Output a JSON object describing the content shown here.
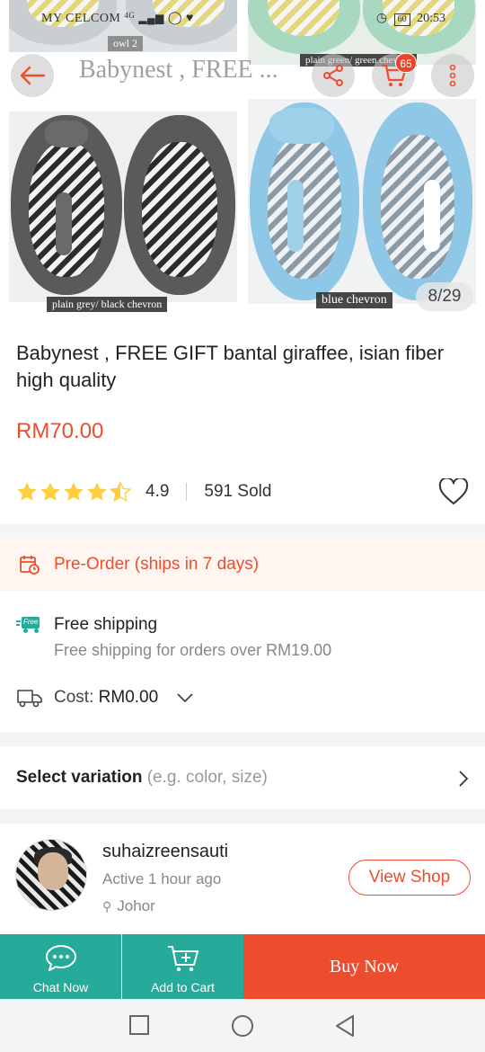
{
  "status_bar": {
    "carrier": "MY CELCOM",
    "network": "4G",
    "battery": "60",
    "time": "20:53"
  },
  "toolbar": {
    "title": "Babynest , FREE ...",
    "cart_count": "65",
    "icons": [
      "back-arrow-icon",
      "share-icon",
      "cart-icon",
      "more-icon"
    ]
  },
  "gallery": {
    "captions": [
      "owl 2",
      "plain green/ green chevron",
      "plain grey/ black chevron",
      "blue chevron"
    ],
    "counter": "8/29"
  },
  "product": {
    "title": "Babynest , FREE GIFT bantal giraffee, isian fiber high quality",
    "price": "RM70.00",
    "rating": "4.9",
    "rating_stars": 4.5,
    "sold": "591 Sold"
  },
  "preorder": {
    "text": "Pre-Order (ships in 7 days)"
  },
  "shipping": {
    "badge": "Free",
    "title": "Free shipping",
    "subtitle": "Free shipping for orders over RM19.00",
    "cost_label": "Cost:",
    "cost_value": "RM0.00"
  },
  "variation": {
    "label": "Select variation",
    "hint": "(e.g. color, size)"
  },
  "shop": {
    "name": "suhaizreensauti",
    "active": "Active 1 hour ago",
    "location": "Johor",
    "button": "View Shop"
  },
  "bottom_bar": {
    "chat": "Chat Now",
    "add_to_cart": "Add to Cart",
    "buy_now": "Buy Now"
  },
  "colors": {
    "brand": "#ee4d2d",
    "teal": "#26aa99",
    "star": "#ffce3d"
  }
}
